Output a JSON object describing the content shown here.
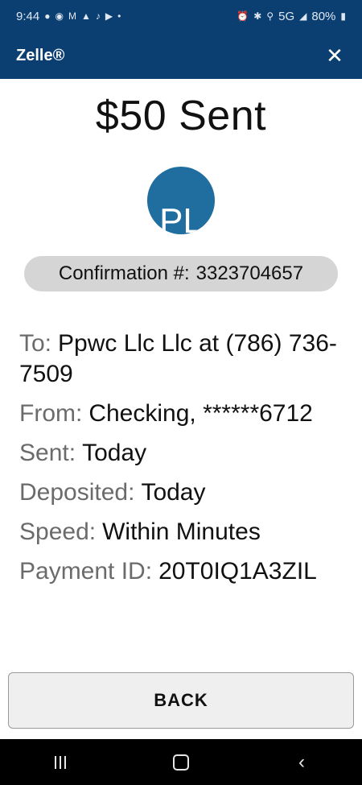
{
  "status_bar": {
    "time": "9:44",
    "network": "5G",
    "battery": "80%",
    "left_icons": [
      "chat-icon",
      "messenger-icon",
      "gmail-icon",
      "maps-icon",
      "tiktok-icon",
      "youtube-icon",
      "dot-icon"
    ],
    "right_icons": [
      "alarm-icon",
      "bluetooth-icon",
      "location-icon",
      "signal-icon",
      "battery-icon"
    ]
  },
  "app_bar": {
    "title": "Zelle®",
    "close_icon": "close-icon"
  },
  "header": {
    "amount_title": "$50 Sent"
  },
  "avatar": {
    "initials": "PL",
    "color": "#1f6e9f"
  },
  "confirmation": {
    "label": "Confirmation #:",
    "number": "3323704657"
  },
  "details": {
    "to_label": "To:",
    "to_value": "Ppwc Llc Llc at (786) 736-7509",
    "from_label": "From:",
    "from_value": "Checking, ******6712",
    "sent_label": "Sent:",
    "sent_value": "Today",
    "deposited_label": "Deposited:",
    "deposited_value": "Today",
    "speed_label": "Speed:",
    "speed_value": "Within Minutes",
    "payment_id_label": "Payment ID:",
    "payment_id_value": "20T0IQ1A3ZIL"
  },
  "actions": {
    "back_label": "BACK"
  },
  "colors": {
    "header_bg": "#0b3f72",
    "pill_bg": "#d5d5d5",
    "label_gray": "#6b6b6b"
  }
}
